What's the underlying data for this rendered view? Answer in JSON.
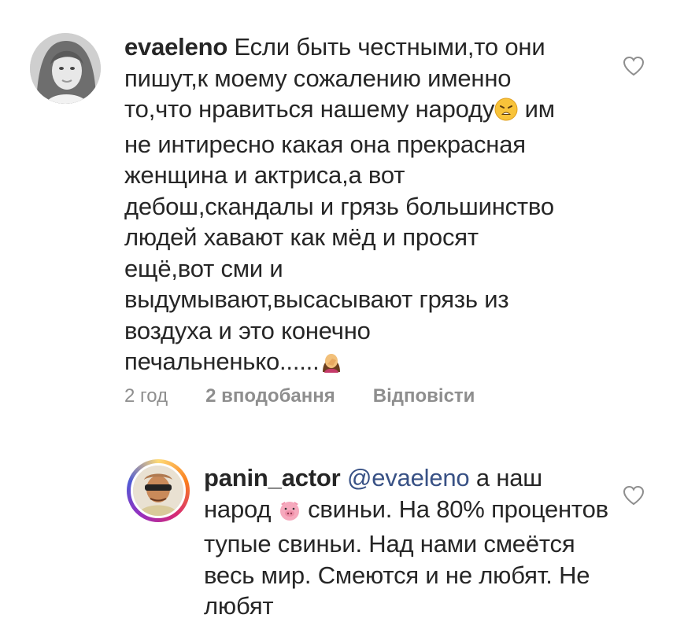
{
  "comments": [
    {
      "username": "evaeleno",
      "avatar": "woman-portrait-grayscale",
      "segments": [
        {
          "text": " Если быть честными,то они пишут,к моему сожалению именно то,что нравиться нашему народу"
        },
        {
          "emoji": "weary-face-emoji"
        },
        {
          "text": " им не интиресно какая она прекрасная женщина и актриса,а вот дебош,скандалы и грязь большинство людей хавают как мёд и просят ещё,вот сми и выдумывают,высасывают грязь из воздуха и это конечно печальненько......"
        },
        {
          "emoji": "woman-facepalming-emoji"
        }
      ],
      "time": "2 год",
      "likes": "2 вподобання",
      "reply": "Відповісти"
    },
    {
      "username": "panin_actor",
      "avatar": "man-with-sunglasses",
      "mention": "@evaeleno",
      "segments_a": " а наш народ ",
      "emoji": "pig-face-emoji",
      "segments_b": " свиньи. На 80% процентов тупые свиньи. Над нами смеётся весь мир. Смеются и не любят. Не любят"
    }
  ],
  "colors": {
    "text": "#262626",
    "meta": "#8e8e8e",
    "mention": "#385185",
    "heart_stroke": "#8e8e8e"
  }
}
